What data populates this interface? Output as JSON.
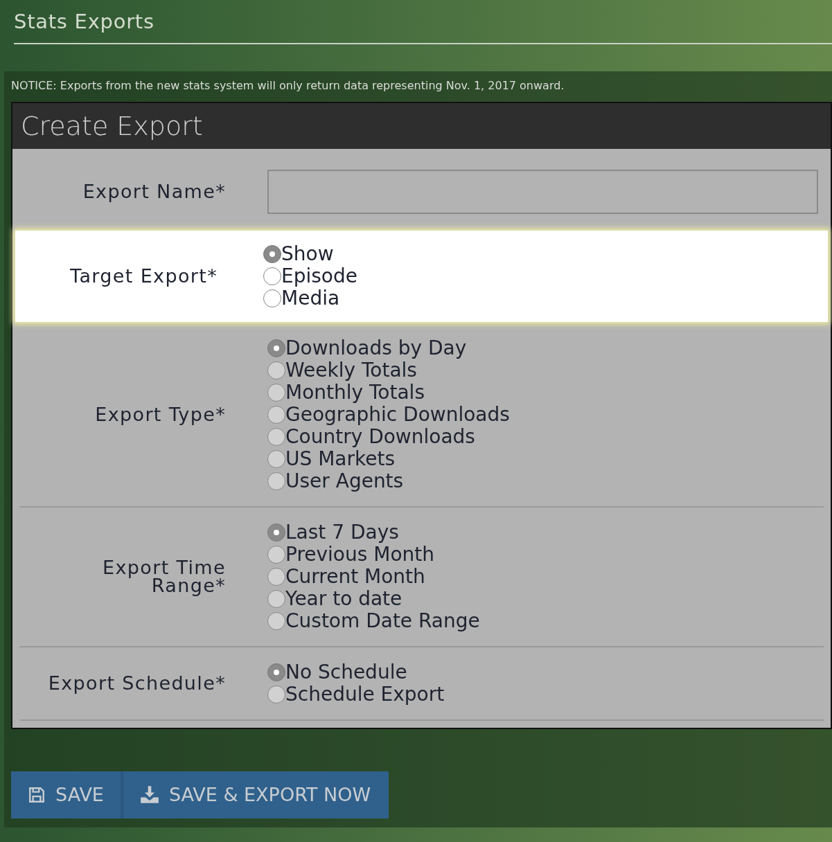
{
  "page_title": "Stats Exports",
  "notice": "NOTICE: Exports from the new stats system will only return data representing Nov. 1, 2017 onward.",
  "form": {
    "title": "Create Export",
    "fields": [
      {
        "kind": "text",
        "label": "Export Name*",
        "highlighted": false
      },
      {
        "kind": "radio",
        "label": "Target Export*",
        "highlighted": true,
        "options": [
          {
            "label": "Show",
            "selected": true
          },
          {
            "label": "Episode",
            "selected": false
          },
          {
            "label": "Media",
            "selected": false
          }
        ]
      },
      {
        "kind": "radio",
        "label": "Export Type*",
        "highlighted": false,
        "options": [
          {
            "label": "Downloads by Day",
            "selected": true
          },
          {
            "label": "Weekly Totals",
            "selected": false
          },
          {
            "label": "Monthly Totals",
            "selected": false
          },
          {
            "label": "Geographic Downloads",
            "selected": false
          },
          {
            "label": "Country Downloads",
            "selected": false
          },
          {
            "label": "US Markets",
            "selected": false
          },
          {
            "label": "User Agents",
            "selected": false
          }
        ]
      },
      {
        "kind": "radio",
        "label": "Export Time Range*",
        "highlighted": false,
        "options": [
          {
            "label": "Last 7 Days",
            "selected": true
          },
          {
            "label": "Previous Month",
            "selected": false
          },
          {
            "label": "Current Month",
            "selected": false
          },
          {
            "label": "Year to date",
            "selected": false
          },
          {
            "label": "Custom Date Range",
            "selected": false
          }
        ]
      },
      {
        "kind": "radio",
        "label": "Export Schedule*",
        "highlighted": false,
        "options": [
          {
            "label": "No Schedule",
            "selected": true
          },
          {
            "label": "Schedule Export",
            "selected": false
          }
        ]
      }
    ]
  },
  "buttons": [
    {
      "kind": "save",
      "label": "SAVE"
    },
    {
      "kind": "export",
      "label": "SAVE & EXPORT NOW"
    }
  ]
}
